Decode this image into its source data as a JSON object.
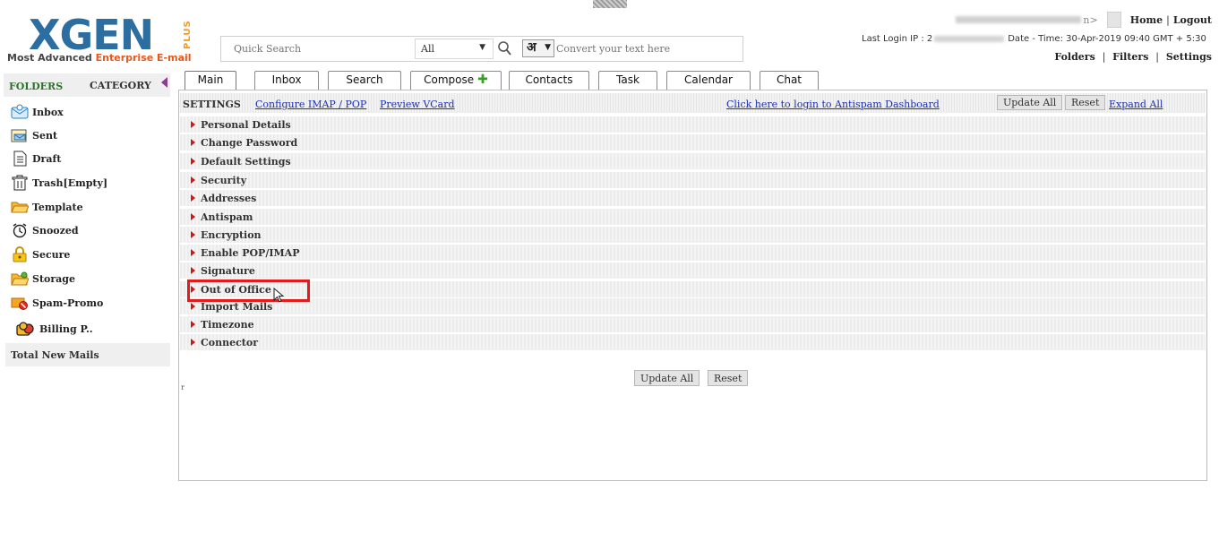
{
  "header": {
    "logo": {
      "word": "XGEN",
      "plus": "PLUS",
      "tagline_main": "Most Advanced ",
      "tagline_highlight": "Enterprise E-mail"
    },
    "search": {
      "placeholder": "Quick Search",
      "scope": "All",
      "lang_glyph": "अ",
      "convert_placeholder": "Convert your text here"
    },
    "user": {
      "suffix": "n>",
      "home": "Home",
      "separator": "|",
      "logout": "Logout"
    },
    "login": {
      "ip_label": "Last Login IP : 2",
      "datetime": "Date - Time: 30-Apr-2019 09:40 GMT + 5:30"
    },
    "links": {
      "folders": "Folders",
      "filters": "Filters",
      "settings": "Settings",
      "separator": "|"
    }
  },
  "sidebar": {
    "folders_label": "FOLDERS",
    "category_label": "CATEGORY",
    "items": [
      {
        "label": "Inbox",
        "icon": "inbox-icon"
      },
      {
        "label": "Sent",
        "icon": "sent-icon"
      },
      {
        "label": "Draft",
        "icon": "draft-icon"
      },
      {
        "label": "Trash[Empty]",
        "icon": "trash-icon"
      },
      {
        "label": "Template",
        "icon": "template-folder-icon"
      },
      {
        "label": "Snoozed",
        "icon": "alarm-clock-icon"
      },
      {
        "label": "Secure",
        "icon": "padlock-icon"
      },
      {
        "label": "Storage",
        "icon": "storage-folder-icon"
      },
      {
        "label": "Spam-Promo",
        "icon": "spam-icon"
      },
      {
        "label": "Billing P..",
        "icon": "billing-icon"
      }
    ],
    "total_new_mails": "Total New Mails"
  },
  "tabs": [
    {
      "label": "Main",
      "active": true
    },
    {
      "label": "Inbox"
    },
    {
      "label": "Search"
    },
    {
      "label": "Compose"
    },
    {
      "label": "Contacts"
    },
    {
      "label": "Task"
    },
    {
      "label": "Calendar"
    },
    {
      "label": "Chat"
    }
  ],
  "settings": {
    "title": "SETTINGS",
    "configure_link": "Configure IMAP / POP",
    "vcard_link": "Preview VCard",
    "antispam_link": "Click here to login to Antispam Dashboard",
    "update_all": "Update All",
    "reset": "Reset",
    "expand_all": "Expand All",
    "sections": [
      "Personal Details",
      "Change Password",
      "Default Settings",
      "Security",
      "Addresses",
      "Antispam",
      "Encryption",
      "Enable POP/IMAP",
      "Signature",
      "Out of Office",
      "Import Mails",
      "Timezone",
      "Connector"
    ],
    "highlighted_section": "Out of Office",
    "bottom_update_all": "Update All",
    "bottom_reset": "Reset",
    "corner_mark": "r"
  },
  "colors": {
    "logo_blue": "#2d6ea0",
    "logo_orange": "#e8571c",
    "highlight_red": "#e31b1b",
    "link_blue": "#1a2fb3",
    "folders_green": "#2e6f2e"
  }
}
